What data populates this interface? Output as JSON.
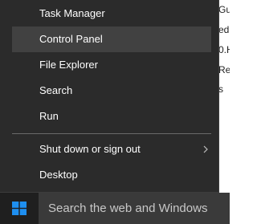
{
  "background_window": {
    "lines": [
      "Gu",
      "ed",
      "0.H",
      "Re",
      "s"
    ]
  },
  "menu": {
    "items": [
      {
        "label": "Task Manager"
      },
      {
        "label": "Control Panel"
      },
      {
        "label": "File Explorer"
      },
      {
        "label": "Search"
      },
      {
        "label": "Run"
      },
      {
        "label": "Shut down or sign out"
      },
      {
        "label": "Desktop"
      }
    ],
    "highlighted": "Control Panel"
  },
  "taskbar": {
    "search_placeholder": "Search the web and Windows",
    "start_icon": "windows-logo-icon"
  },
  "colors": {
    "menu_bg": "#2b2b2b",
    "highlight_bg": "#414141",
    "taskbar_bg": "#1f1f1f",
    "search_bg": "#3a3a3a",
    "accent_blue": "#1e8ff0"
  }
}
